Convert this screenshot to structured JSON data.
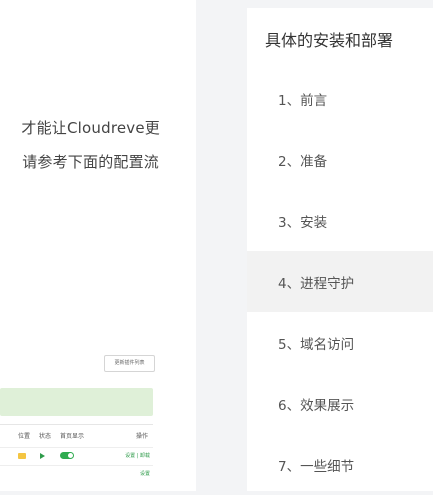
{
  "article": {
    "line1": "才能让Cloudreve更",
    "line2": "请参考下面的配置流"
  },
  "screenshot": {
    "button_label": "更新插件列表",
    "headers": [
      "位置",
      "状态",
      "首页显示",
      "操作"
    ],
    "row_links": "设置 | 卸载",
    "row2_link": "设置"
  },
  "toc": {
    "title": "具体的安装和部署",
    "items": [
      {
        "label": "1、前言"
      },
      {
        "label": "2、准备"
      },
      {
        "label": "3、安装"
      },
      {
        "label": "4、进程守护"
      },
      {
        "label": "5、域名访问"
      },
      {
        "label": "6、效果展示"
      },
      {
        "label": "7、一些细节"
      }
    ],
    "active_index": 3
  }
}
